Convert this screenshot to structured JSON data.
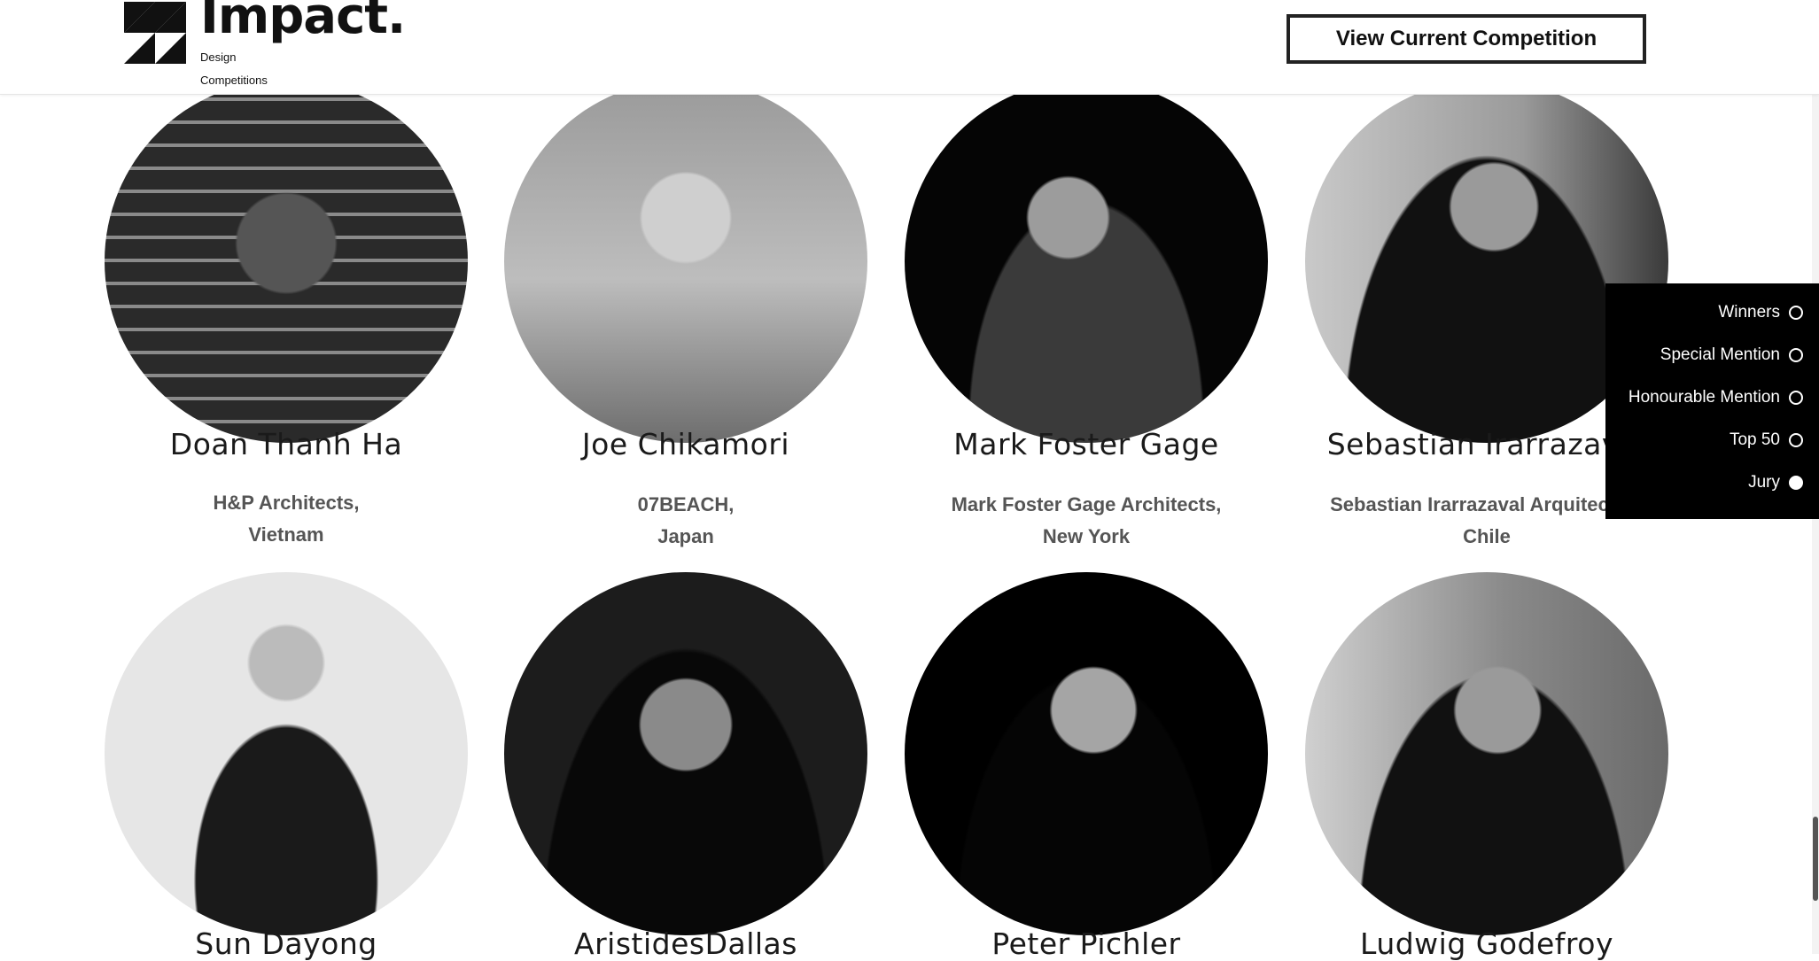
{
  "header": {
    "logo_title": "Impact.",
    "logo_sub1": "Design",
    "logo_sub2": "Competitions",
    "cta_label": "View Current Competition"
  },
  "jury": [
    {
      "name": "Doan Thanh Ha",
      "firm": "H&P Architects,",
      "location": "Vietnam"
    },
    {
      "name": "Joe Chikamori",
      "firm": "07BEACH,",
      "location": "Japan"
    },
    {
      "name": "Mark Foster Gage",
      "firm": "Mark Foster Gage Architects,",
      "location": "New York"
    },
    {
      "name": "Sebastian Irarrazaval",
      "firm": "Sebastian Irarrazaval Arquitectos,",
      "location": "Chile"
    },
    {
      "name": "Sun Dayong",
      "firm": "",
      "location": ""
    },
    {
      "name": "AristidesDallas",
      "firm": "",
      "location": ""
    },
    {
      "name": "Peter Pichler",
      "firm": "",
      "location": ""
    },
    {
      "name": "Ludwig Godefroy",
      "firm": "",
      "location": ""
    }
  ],
  "filter": {
    "items": [
      {
        "label": "Winners",
        "selected": false
      },
      {
        "label": "Special Mention",
        "selected": false
      },
      {
        "label": "Honourable Mention",
        "selected": false
      },
      {
        "label": "Top 50",
        "selected": false
      },
      {
        "label": "Jury",
        "selected": true
      }
    ]
  }
}
